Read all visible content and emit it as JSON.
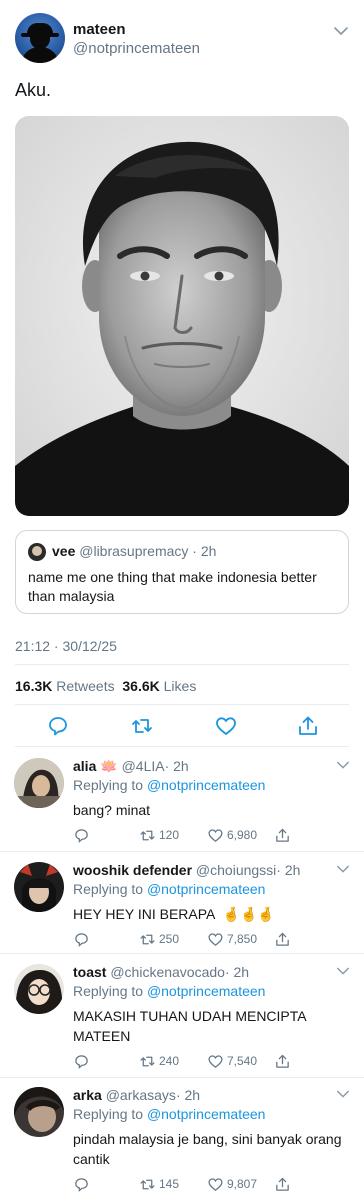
{
  "tweet": {
    "display_name": "mateen",
    "handle": "@notprincemateen",
    "text": "Aku.",
    "timestamp": "21:12 · 30/12/25",
    "retweets_count": "16.3K",
    "retweets_label": "Retweets",
    "likes_count": "36.6K",
    "likes_label": "Likes"
  },
  "quoted_tweet": {
    "display_name": "vee",
    "handle": "@librasupremacy",
    "time": "· 2h",
    "text": "name me one thing that make indonesia better than malaysia"
  },
  "replies": [
    {
      "display_name": "alia",
      "emoji": "🪷",
      "handle": "@4LIA",
      "time": "· 2h",
      "replying_prefix": "Replying to",
      "replying_to": "@notprincemateen",
      "text": "bang? minat",
      "retweets": "120",
      "likes": "6,980"
    },
    {
      "display_name": "wooshik defender",
      "handle": "@choiungssi",
      "time": "· 2h",
      "replying_prefix": "Replying to",
      "replying_to": "@notprincemateen",
      "text": "HEY HEY INI BERAPA",
      "retweets": "250",
      "likes": "7,850"
    },
    {
      "display_name": "toast",
      "handle": "@chickenavocado",
      "time": "· 2h",
      "replying_prefix": "Replying to",
      "replying_to": "@notprincemateen",
      "text": "MAKASIH TUHAN UDAH MENCIPTA MATEEN",
      "retweets": "240",
      "likes": "7,540"
    },
    {
      "display_name": "arka",
      "handle": "@arkasays",
      "time": "· 2h",
      "replying_prefix": "Replying to",
      "replying_to": "@notprincemateen",
      "text": "pindah malaysia je bang, sini banyak orang cantik",
      "retweets": "145",
      "likes": "9,807"
    }
  ],
  "icons": {
    "reply": "reply-icon",
    "retweet": "retweet-icon",
    "like": "heart-icon",
    "share": "share-icon",
    "more": "chevron-down-icon",
    "crossed_fingers": "crossed-fingers-emoji"
  },
  "colors": {
    "link_blue": "#1b95e0",
    "secondary_grey": "#657786",
    "text": "#14171a",
    "divider": "#e6ecf0"
  }
}
